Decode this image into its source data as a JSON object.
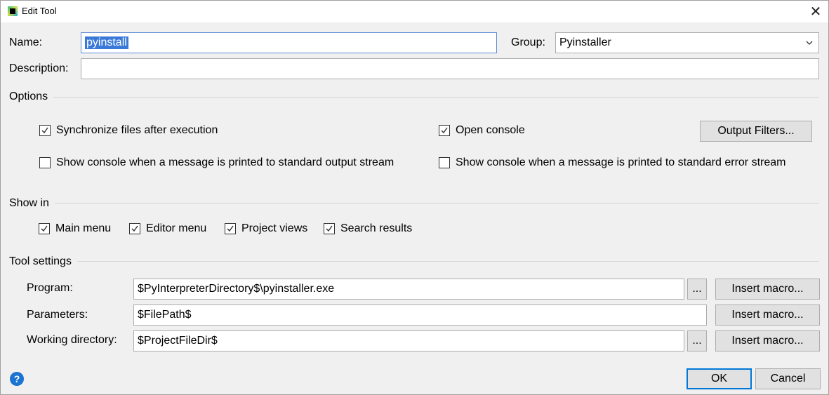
{
  "window": {
    "title": "Edit Tool",
    "close_glyph": "✕"
  },
  "form": {
    "name_label": "Name:",
    "name_value": "pyinstall",
    "group_label": "Group:",
    "group_value": "Pyinstaller",
    "description_label": "Description:",
    "description_value": ""
  },
  "options": {
    "title": "Options",
    "sync_files": {
      "label": "Synchronize files after execution",
      "checked": true
    },
    "open_console": {
      "label": "Open console",
      "checked": true
    },
    "output_filters_label": "Output Filters...",
    "show_console_stdout": {
      "label": "Show console when a message is printed to standard output stream",
      "checked": false
    },
    "show_console_stderr": {
      "label": "Show console when a message is printed to standard error stream",
      "checked": false
    }
  },
  "show_in": {
    "title": "Show in",
    "main_menu": {
      "label": "Main menu",
      "checked": true
    },
    "editor_menu": {
      "label": "Editor menu",
      "checked": true
    },
    "project_views": {
      "label": "Project views",
      "checked": true
    },
    "search_results": {
      "label": "Search results",
      "checked": true
    }
  },
  "tool_settings": {
    "title": "Tool settings",
    "program_label": "Program:",
    "program_value": "$PyInterpreterDirectory$\\pyinstaller.exe",
    "parameters_label": "Parameters:",
    "parameters_value": "$FilePath$",
    "working_dir_label": "Working directory:",
    "working_dir_value": "$ProjectFileDir$",
    "browse_label": "...",
    "insert_macro_label": "Insert macro..."
  },
  "footer": {
    "help_glyph": "?",
    "ok_label": "OK",
    "cancel_label": "Cancel"
  },
  "colors": {
    "accent": "#0078d7",
    "selection": "#3a79d8",
    "help": "#1b74d1"
  }
}
